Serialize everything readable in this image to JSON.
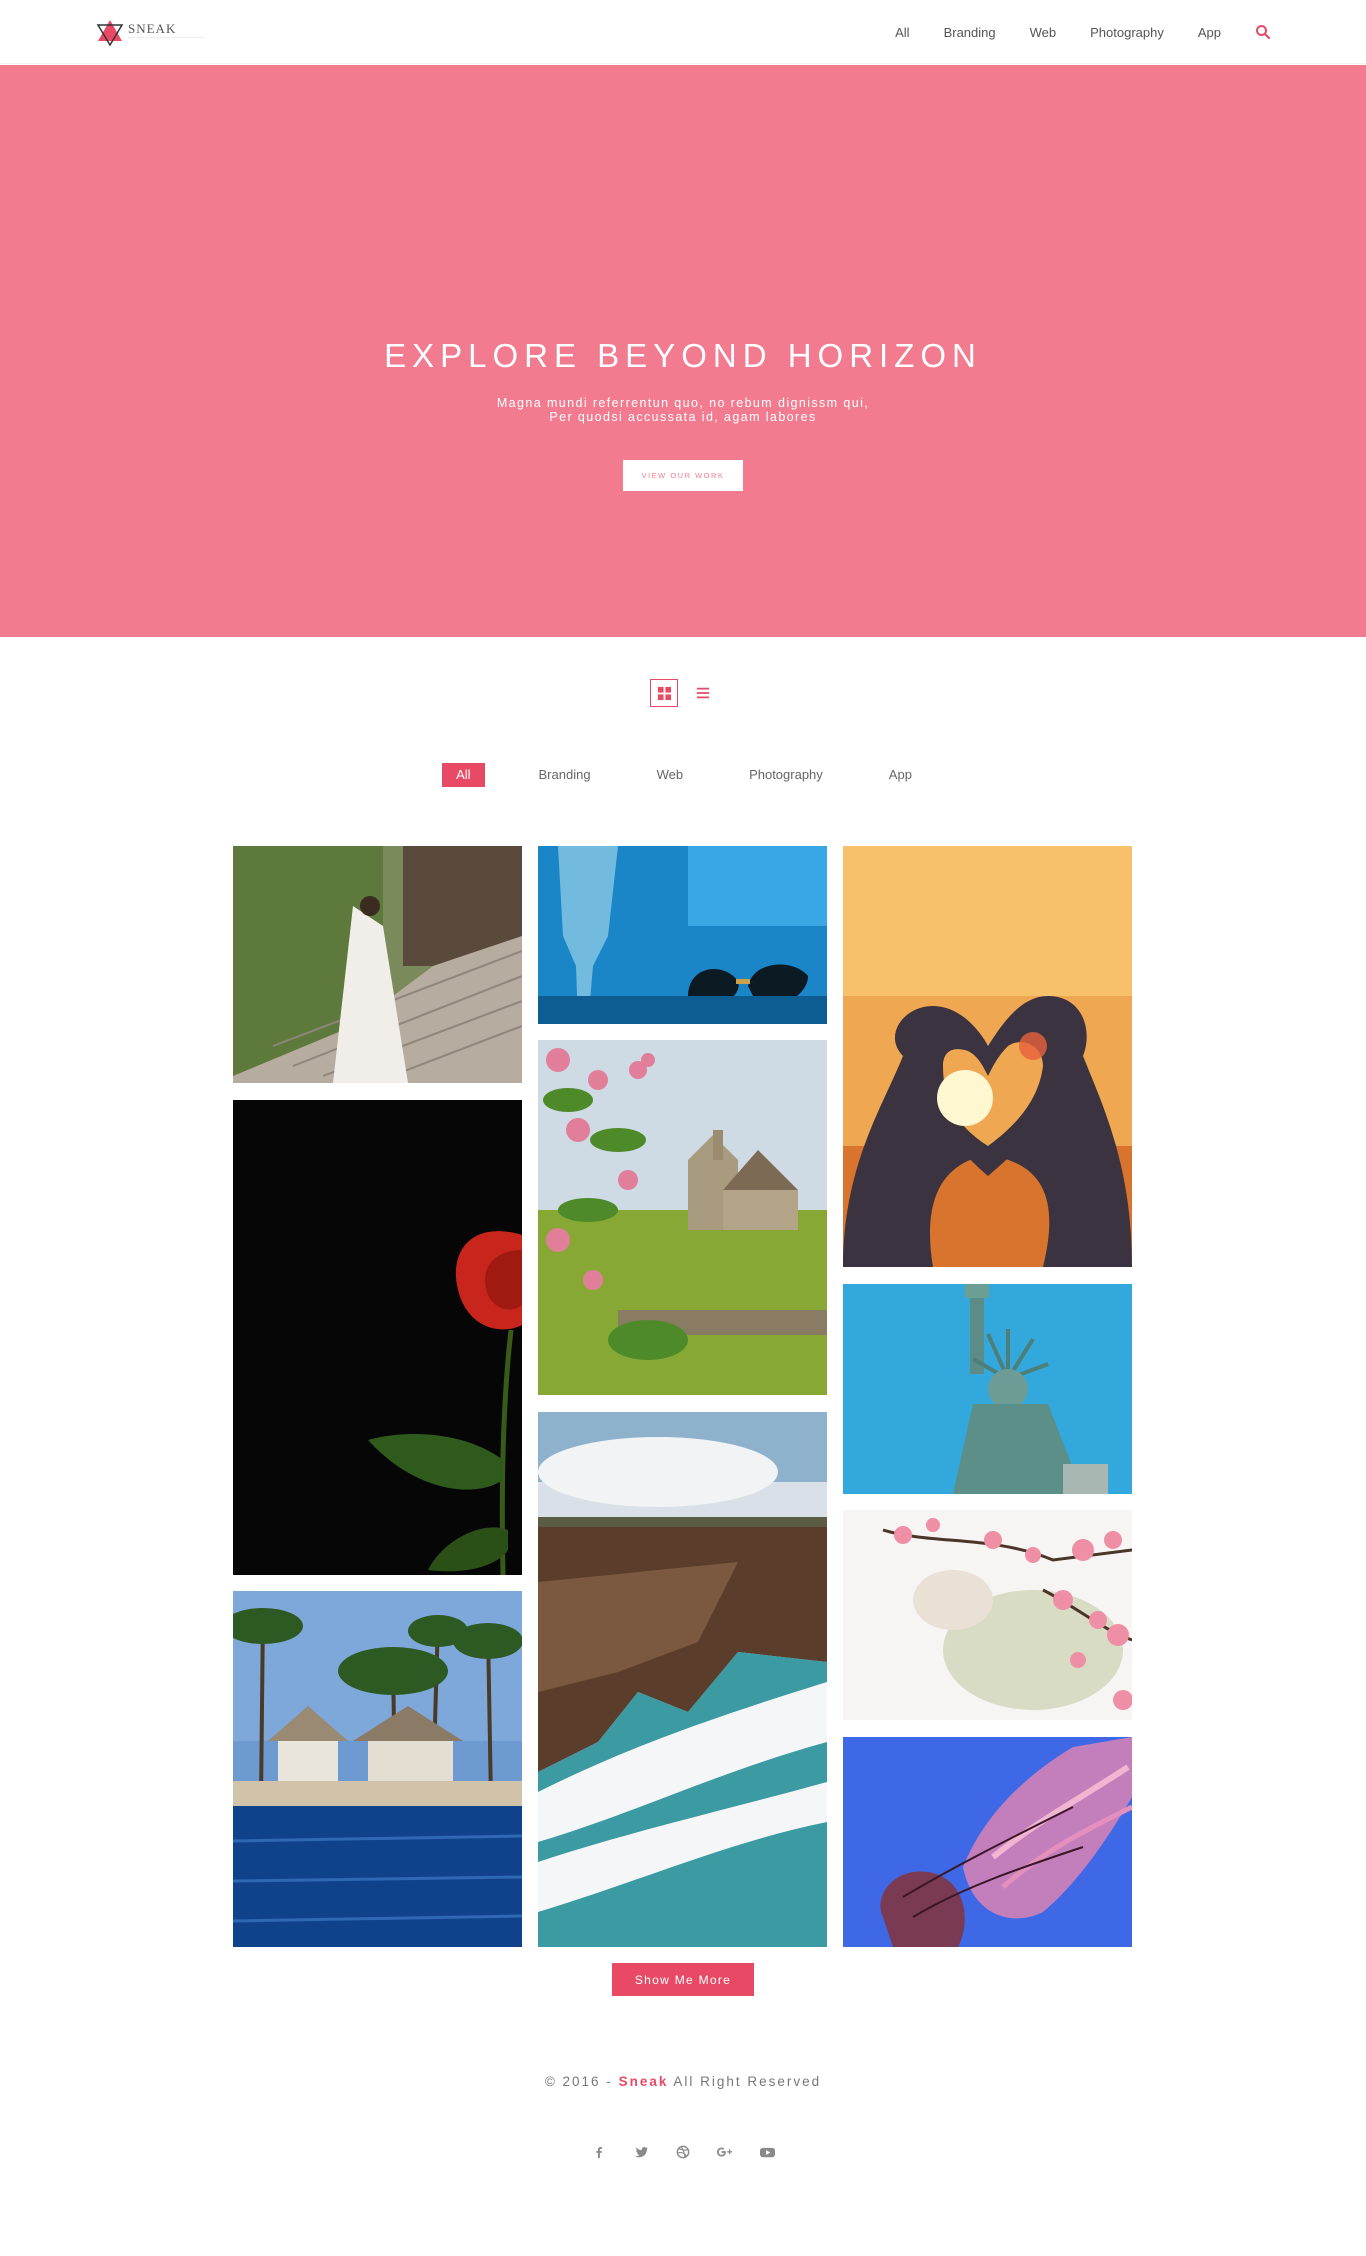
{
  "header": {
    "logo_text": "SNEAK",
    "nav": [
      "All",
      "Branding",
      "Web",
      "Photography",
      "App"
    ]
  },
  "hero": {
    "title": "EXPLORE BEYOND HORIZON",
    "subtitle_line1": "Magna mundi referrentun quo, no rebum dignissm qui,",
    "subtitle_line2": "Per quodsi accussata id, agam labores",
    "button_label": "VIEW OUR WORK"
  },
  "filters": {
    "items": [
      "All",
      "Branding",
      "Web",
      "Photography",
      "App"
    ],
    "active": "All"
  },
  "portfolio": {
    "more_label": "Show Me More"
  },
  "footer": {
    "copy_prefix": "© 2016 - ",
    "brand": "Sneak",
    "copy_suffix": " All Right Reserved",
    "social_icons": [
      "facebook-icon",
      "twitter-icon",
      "dribbble-icon",
      "google-plus-icon",
      "youtube-icon"
    ]
  },
  "colors": {
    "accent": "#e84a65",
    "hero_bg": "#f27b8f"
  }
}
